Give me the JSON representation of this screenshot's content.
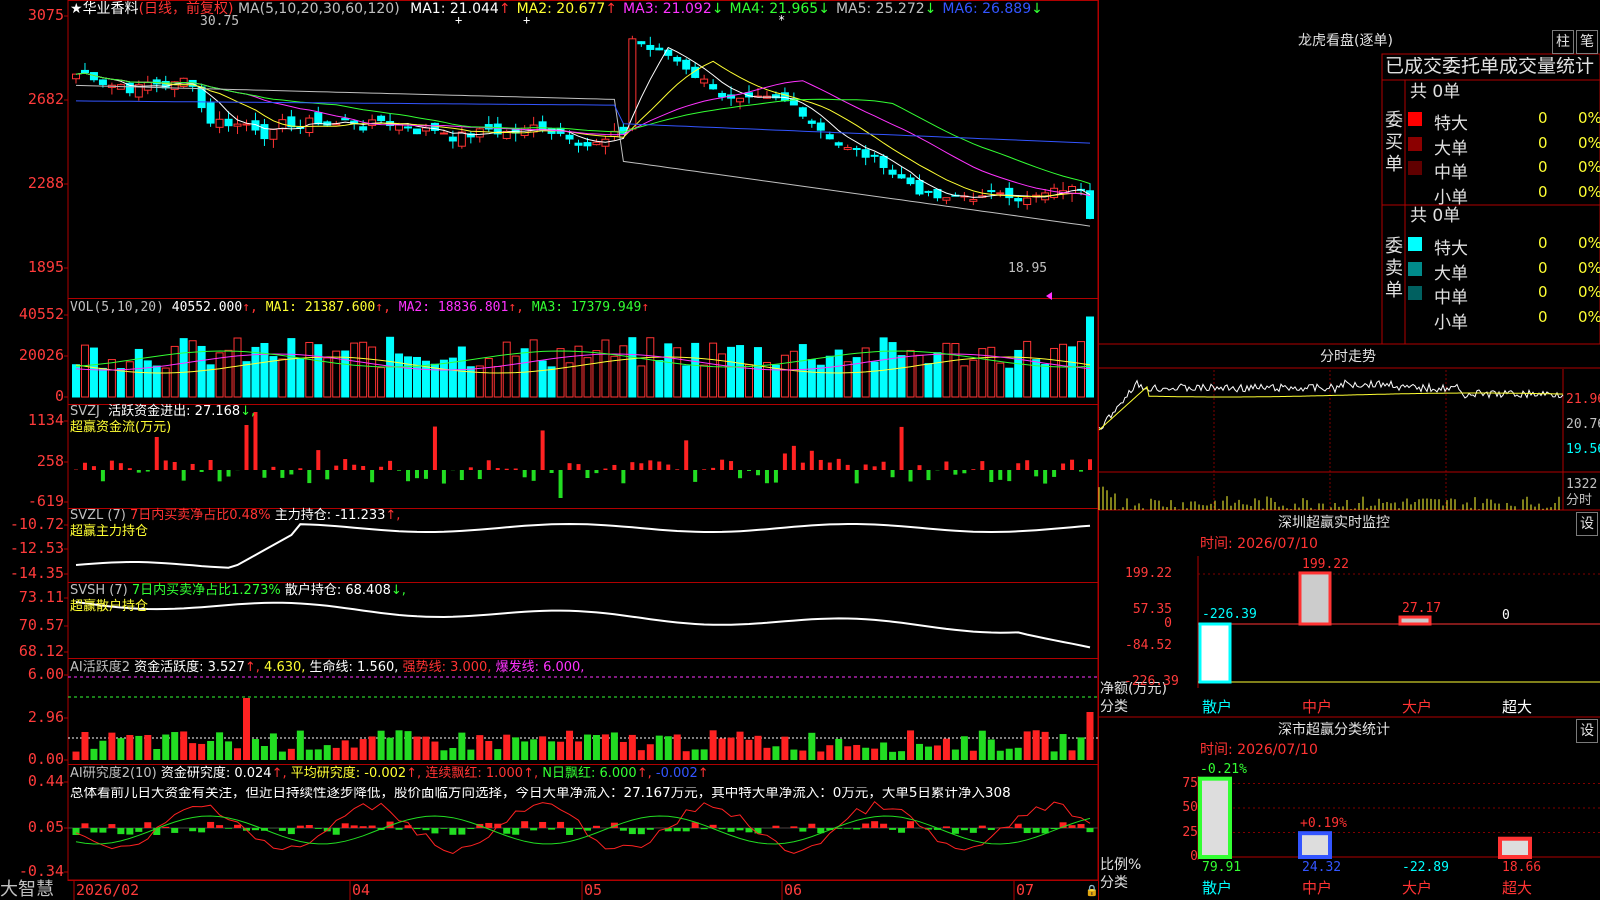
{
  "app": {
    "brand": "大智慧"
  },
  "kline": {
    "star": "★",
    "stock_name": "华业香料",
    "period": "(日线，前复权)",
    "ma_header": "MA(5,10,20,30,60,120)",
    "ma": [
      {
        "label": "MA1:",
        "value": "21.044",
        "arrow": "↑",
        "color": "#ffffff"
      },
      {
        "label": "MA2:",
        "value": "20.677",
        "arrow": "↑",
        "color": "#ffff33"
      },
      {
        "label": "MA3:",
        "value": "21.092",
        "arrow": "↓",
        "color": "#ff33ff"
      },
      {
        "label": "MA4:",
        "value": "21.965",
        "arrow": "↓",
        "color": "#33ff33"
      },
      {
        "label": "MA5:",
        "value": "25.272",
        "arrow": "↓",
        "color": "#c0c0c0"
      },
      {
        "label": "MA6:",
        "value": "26.889",
        "arrow": "↓",
        "color": "#3355ff"
      }
    ],
    "y_ticks": [
      "3075",
      "2682",
      "2288",
      "1895"
    ],
    "high_mark": "30.75",
    "low_mark": "18.95"
  },
  "vol": {
    "header": "VOL(5,10,20)",
    "value": "40552.000",
    "ma1": "MA1: 21387.600",
    "ma2": "MA2: 18836.801",
    "ma3": "MA3: 17379.949",
    "y_ticks": [
      "40552",
      "20026",
      "0"
    ]
  },
  "svzj": {
    "header": "SVZJ",
    "label": "活跃资金进出: 27.168",
    "arrow": "↓,",
    "subtitle": "超赢资金流(万元)",
    "y_ticks": [
      "1134",
      "258",
      "-619"
    ]
  },
  "svzl": {
    "header": "SVZL (7)",
    "label1": "7日内买卖净占比0.48%",
    "label2": "主力持仓: -11.233",
    "arrow": "↑,",
    "subtitle": "超赢主力持仓",
    "y_ticks": [
      "-10.72",
      "-12.53",
      "-14.35"
    ]
  },
  "svsh": {
    "header": "SVSH (7)",
    "label1": "7日内买卖净占比1.273%",
    "label2": "散户持仓: 68.408",
    "arrow": "↓,",
    "subtitle": "超赢散户持仓",
    "y_ticks": [
      "73.11",
      "70.57",
      "68.12"
    ]
  },
  "ai_active": {
    "header": "AI活跃度2",
    "label1": "资金活跃度: 3.527",
    "v2": "4.630,",
    "label3": "生命线: 1.560,",
    "label4": "强势线: 3.000,",
    "label5": "爆发线: 6.000,",
    "y_ticks": [
      "6.00",
      "2.96",
      "0.00"
    ]
  },
  "ai_research": {
    "header": "AI研究度2(10)",
    "label1": "资金研究度: 0.024",
    "label2": "平均研究度: -0.002",
    "label3": "连续飘红: 1.000",
    "label4": "N日飘红: 6.000",
    "label5": "-0.002",
    "summary": "总体看前几日大资金有关注，但近日持续性逐步降低，股价面临方向选择，今日大单净流入：27.167万元，其中特大单净流入：0万元，大单5日累计净入308",
    "y_ticks": [
      "0.44",
      "0.05",
      "-0.34"
    ]
  },
  "x_axis": [
    "2026/02",
    "04",
    "05",
    "06",
    "07"
  ],
  "right": {
    "dragon_title": "龙虎看盘(逐单)",
    "btn_bar": "柱",
    "btn_pen": "笔",
    "tabs": "已成交委托单成交量统计",
    "buy_label": "委买单",
    "sell_label": "委卖单",
    "buy_total": "共 0单",
    "sell_total": "共 0单",
    "buy_rows": [
      {
        "label": "特大",
        "n": "0",
        "p": "0%",
        "color": "#ff0000"
      },
      {
        "label": "大单",
        "n": "0",
        "p": "0%",
        "color": "#8b0000"
      },
      {
        "label": "中单",
        "n": "0",
        "p": "0%",
        "color": "#600000"
      },
      {
        "label": "小单",
        "n": "0",
        "p": "0%",
        "color": "#000000"
      }
    ],
    "sell_rows": [
      {
        "label": "特大",
        "n": "0",
        "p": "0%",
        "color": "#00ffff"
      },
      {
        "label": "大单",
        "n": "0",
        "p": "0%",
        "color": "#008b8b"
      },
      {
        "label": "中单",
        "n": "0",
        "p": "0%",
        "color": "#006060"
      },
      {
        "label": "小单",
        "n": "0",
        "p": "0%",
        "color": "#000000"
      }
    ],
    "intraday_title": "分时走势",
    "intraday_y": [
      "21.96",
      "20.76",
      "19.56",
      "1322",
      "分时"
    ],
    "sz_title": "深圳超赢实时监控",
    "sz_btn": "设",
    "sz_time": "时间: 2026/07/10",
    "sz_y": [
      "199.22",
      "57.35",
      "0",
      "-84.52",
      "-226.39"
    ],
    "sz_left1": "净额(万元)",
    "sz_left2": "分类",
    "sz_cats": [
      "散户",
      "中户",
      "大户",
      "超大"
    ],
    "sz_values": [
      "-226.39",
      "199.22",
      "27.17",
      "0"
    ],
    "cls_title": "深市超赢分类统计",
    "cls_btn": "设",
    "cls_time": "时间: 2026/07/10",
    "cls_y": [
      "75",
      "50",
      "25",
      "0"
    ],
    "cls_left1": "比例%",
    "cls_left2": "分类",
    "cls_cats": [
      "散户",
      "中户",
      "大户",
      "超大"
    ],
    "cls_tops": [
      "-0.21%",
      "+0.19%"
    ],
    "cls_values": [
      "79.91",
      "24.32",
      "-22.89",
      "18.66"
    ]
  }
}
